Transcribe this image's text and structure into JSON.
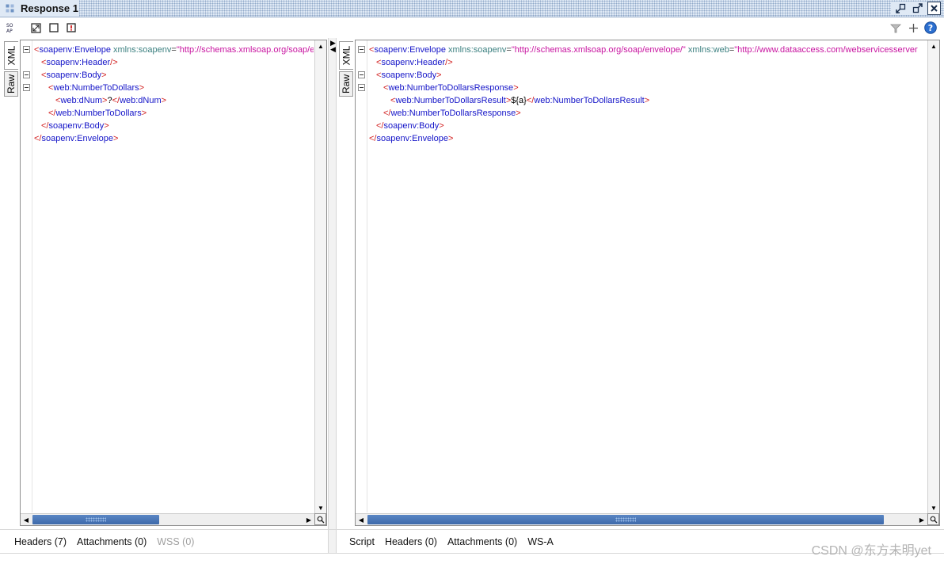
{
  "window": {
    "title": "Response 1",
    "accent": "#dfe9f5"
  },
  "toolbar": {
    "left_icons": [
      "soap-icon",
      "fit-window-icon",
      "single-pane-icon",
      "alert-icon"
    ],
    "right_icons": [
      "funnel-icon",
      "plus-icon",
      "help-icon"
    ]
  },
  "request_editor": {
    "tabs": [
      {
        "label": "XML",
        "active": true
      },
      {
        "label": "Raw",
        "active": false
      }
    ],
    "lines": [
      {
        "indent": 0,
        "parts": [
          [
            "br",
            "<"
          ],
          [
            "tag",
            "soapenv:Envelope"
          ],
          [
            "txt",
            " "
          ],
          [
            "attr",
            "xmlns:soapenv"
          ],
          [
            "eq",
            "="
          ],
          [
            "val",
            "\"http://schemas.xmlsoap.org/soap/en"
          ]
        ]
      },
      {
        "indent": 1,
        "parts": [
          [
            "br",
            "<"
          ],
          [
            "tag",
            "soapenv:Header"
          ],
          [
            "br",
            "/>"
          ]
        ]
      },
      {
        "indent": 1,
        "parts": [
          [
            "br",
            "<"
          ],
          [
            "tag",
            "soapenv:Body"
          ],
          [
            "br",
            ">"
          ]
        ]
      },
      {
        "indent": 2,
        "parts": [
          [
            "br",
            "<"
          ],
          [
            "tag",
            "web:NumberToDollars"
          ],
          [
            "br",
            ">"
          ]
        ]
      },
      {
        "indent": 3,
        "parts": [
          [
            "br",
            "<"
          ],
          [
            "tag",
            "web:dNum"
          ],
          [
            "br",
            ">"
          ],
          [
            "txt",
            "?"
          ],
          [
            "br",
            "</"
          ],
          [
            "tag",
            "web:dNum"
          ],
          [
            "br",
            ">"
          ]
        ]
      },
      {
        "indent": 2,
        "parts": [
          [
            "br",
            "</"
          ],
          [
            "tag",
            "web:NumberToDollars"
          ],
          [
            "br",
            ">"
          ]
        ]
      },
      {
        "indent": 1,
        "parts": [
          [
            "br",
            "</"
          ],
          [
            "tag",
            "soapenv:Body"
          ],
          [
            "br",
            ">"
          ]
        ]
      },
      {
        "indent": 0,
        "parts": [
          [
            "br",
            "</"
          ],
          [
            "tag",
            "soapenv:Envelope"
          ],
          [
            "br",
            ">"
          ]
        ]
      }
    ],
    "folds": [
      0,
      2,
      3
    ]
  },
  "response_editor": {
    "tabs": [
      {
        "label": "XML",
        "active": true
      },
      {
        "label": "Raw",
        "active": false
      }
    ],
    "lines": [
      {
        "indent": 0,
        "parts": [
          [
            "br",
            "<"
          ],
          [
            "tag",
            "soapenv:Envelope"
          ],
          [
            "txt",
            " "
          ],
          [
            "attr",
            "xmlns:soapenv"
          ],
          [
            "eq",
            "="
          ],
          [
            "val",
            "\"http://schemas.xmlsoap.org/soap/envelope/\""
          ],
          [
            "txt",
            " "
          ],
          [
            "attr",
            "xmlns:web"
          ],
          [
            "eq",
            "="
          ],
          [
            "val",
            "\"http://www.dataaccess.com/webservicesserver"
          ]
        ]
      },
      {
        "indent": 1,
        "parts": [
          [
            "br",
            "<"
          ],
          [
            "tag",
            "soapenv:Header"
          ],
          [
            "br",
            "/>"
          ]
        ]
      },
      {
        "indent": 1,
        "parts": [
          [
            "br",
            "<"
          ],
          [
            "tag",
            "soapenv:Body"
          ],
          [
            "br",
            ">"
          ]
        ]
      },
      {
        "indent": 2,
        "parts": [
          [
            "br",
            "<"
          ],
          [
            "tag",
            "web:NumberToDollarsResponse"
          ],
          [
            "br",
            ">"
          ]
        ]
      },
      {
        "indent": 3,
        "parts": [
          [
            "br",
            "<"
          ],
          [
            "tag",
            "web:NumberToDollarsResult"
          ],
          [
            "br",
            ">"
          ],
          [
            "txt",
            "${a}"
          ],
          [
            "br",
            "</"
          ],
          [
            "tag",
            "web:NumberToDollarsResult"
          ],
          [
            "br",
            ">"
          ]
        ]
      },
      {
        "indent": 2,
        "parts": [
          [
            "br",
            "</"
          ],
          [
            "tag",
            "web:NumberToDollarsResponse"
          ],
          [
            "br",
            ">"
          ]
        ]
      },
      {
        "indent": 1,
        "parts": [
          [
            "br",
            "</"
          ],
          [
            "tag",
            "soapenv:Body"
          ],
          [
            "br",
            ">"
          ]
        ]
      },
      {
        "indent": 0,
        "parts": [
          [
            "br",
            "</"
          ],
          [
            "tag",
            "soapenv:Envelope"
          ],
          [
            "br",
            ">"
          ]
        ]
      }
    ],
    "folds": [
      0,
      2,
      3
    ]
  },
  "request_bottom_tabs": [
    {
      "label": "Headers (7)",
      "enabled": true
    },
    {
      "label": "Attachments (0)",
      "enabled": true
    },
    {
      "label": "WSS (0)",
      "enabled": false
    }
  ],
  "response_bottom_tabs": [
    {
      "label": "Script",
      "enabled": true
    },
    {
      "label": "Headers (0)",
      "enabled": true
    },
    {
      "label": "Attachments (0)",
      "enabled": true
    },
    {
      "label": "WS-A",
      "enabled": true
    }
  ],
  "watermark": "CSDN @东方未明yet"
}
